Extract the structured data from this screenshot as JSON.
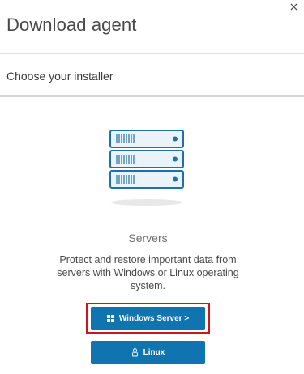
{
  "dialog": {
    "title": "Download agent",
    "close_icon": "close-icon"
  },
  "section": {
    "subtitle": "Choose your installer"
  },
  "installer": {
    "illustration_icon": "server-rack-icon",
    "category": "Servers",
    "description": "Protect and restore important data from servers with Windows or Linux operating system.",
    "buttons": {
      "windows_label": "Windows Server >",
      "windows_icon": "windows-icon",
      "linux_label": "Linux",
      "linux_icon": "linux-icon"
    }
  },
  "colors": {
    "button_blue": "#0f74b0",
    "highlight_red": "#d0141d",
    "server_blue": "#1f6fa8",
    "server_fill": "#eaf3fa"
  }
}
